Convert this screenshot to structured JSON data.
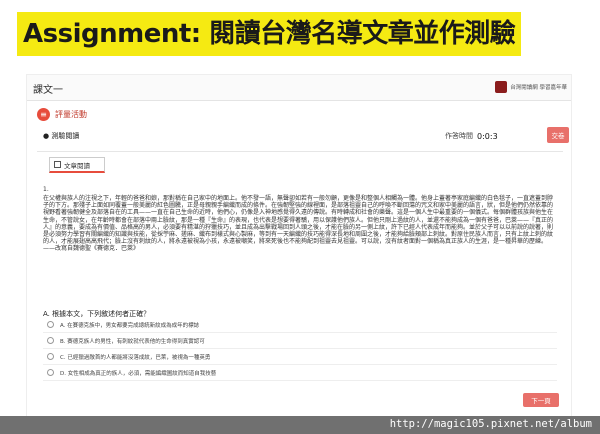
{
  "banner": {
    "title": "Assignment: 閱讀台灣名導文章並作測驗"
  },
  "app": {
    "title": "課文一",
    "brand": "台灣閱讀網 學習嘉年華",
    "activity_label": "評量活動",
    "section_label": "● 測驗閱讀",
    "timer_label": "作答時間",
    "timer_value": "0:0:3",
    "submit_label": "交卷",
    "tab_label": "文章閱讀",
    "next_label": "下一頁"
  },
  "article": {
    "number": "1.",
    "text": "在父權與族人的注視之下，年輕的爸爸和娘，那對稱在自己家中的地面上。他不發一語，無聲卻如若有一般勿顧，更像是和整個人相觸為一體。他身上蓋著亭家庭編織的白色毯子，一直遮蓋到脖子的下方。那殘子上面如同覆蓋一般美麗的紅色圖騰，正是母親親手編織而成的條件。在強韌堅強的線裡面，是部落祖靈自己的呼喚不斷回蕩的咒文和家中美麗的語言，狀，但是他們仍然依靠的視野看著強韌健全及部落自在的工具——一直在自己生命的近時，他們心，仍像是入神地感覺得久遠的傳說。有時轉成和社會的樂聲。這是一個人生中最重要的一個儀式。每個群體孩族與他生在生命，不管說女，在年齡時都會在部落中兩上臉紋，那是一種『生命』的表現，也代表是想要得著驕，用以保護他們族人。但他只剛上過紋的人，並還不能夠成為一個有爸爸，巴萊——『真正的人』的意義，要成為有價值、品格高的男人，必須要有精湛的狩獵技巧，並且成為出擊戰場回到人頭之後，才能在臉的另一側上紋，許下已經人代表成年而能夠。並於父子可以以前說的說著，則是必須努力學習有關編織的知識與技能，從採苧麻、搓麻、織布到樣式與心製麻，等到有一天編織的技巧能得深長地和周圍之後，才能夠給臉頰部上刺紋。對原住民族人而言，只有上紋上刺的紋的人，才能展翅高高飛代；臉上沒有刺紋的人，將永遠被視為小孩，永遠被嘲笑，將來死後也不能夠配到祖靈去見祖靈。可以說，沒有紋者面對一個稱為真正族人的生涯，是一種昇華的歷練。——改寫自魏德聖《賽德克．巴萊》"
  },
  "quiz": {
    "question": "A. 根據本文，下列敘述何者正確？",
    "options": [
      "A. 在賽德克族中，男女都要完成總統新紋成為成年的標誌",
      "B. 賽德克族人的男性，有刺紋就代表他的生命得到真實認可",
      "C. 已經獵過敵首的人都能將沒落成紋，巴萊，被視為一種英勇",
      "D. 女性相成為真正的族人，必須，需能編織圖紋而知道自我技藝"
    ]
  },
  "footer": {
    "url": "http://magic105.pixnet.net/album"
  }
}
